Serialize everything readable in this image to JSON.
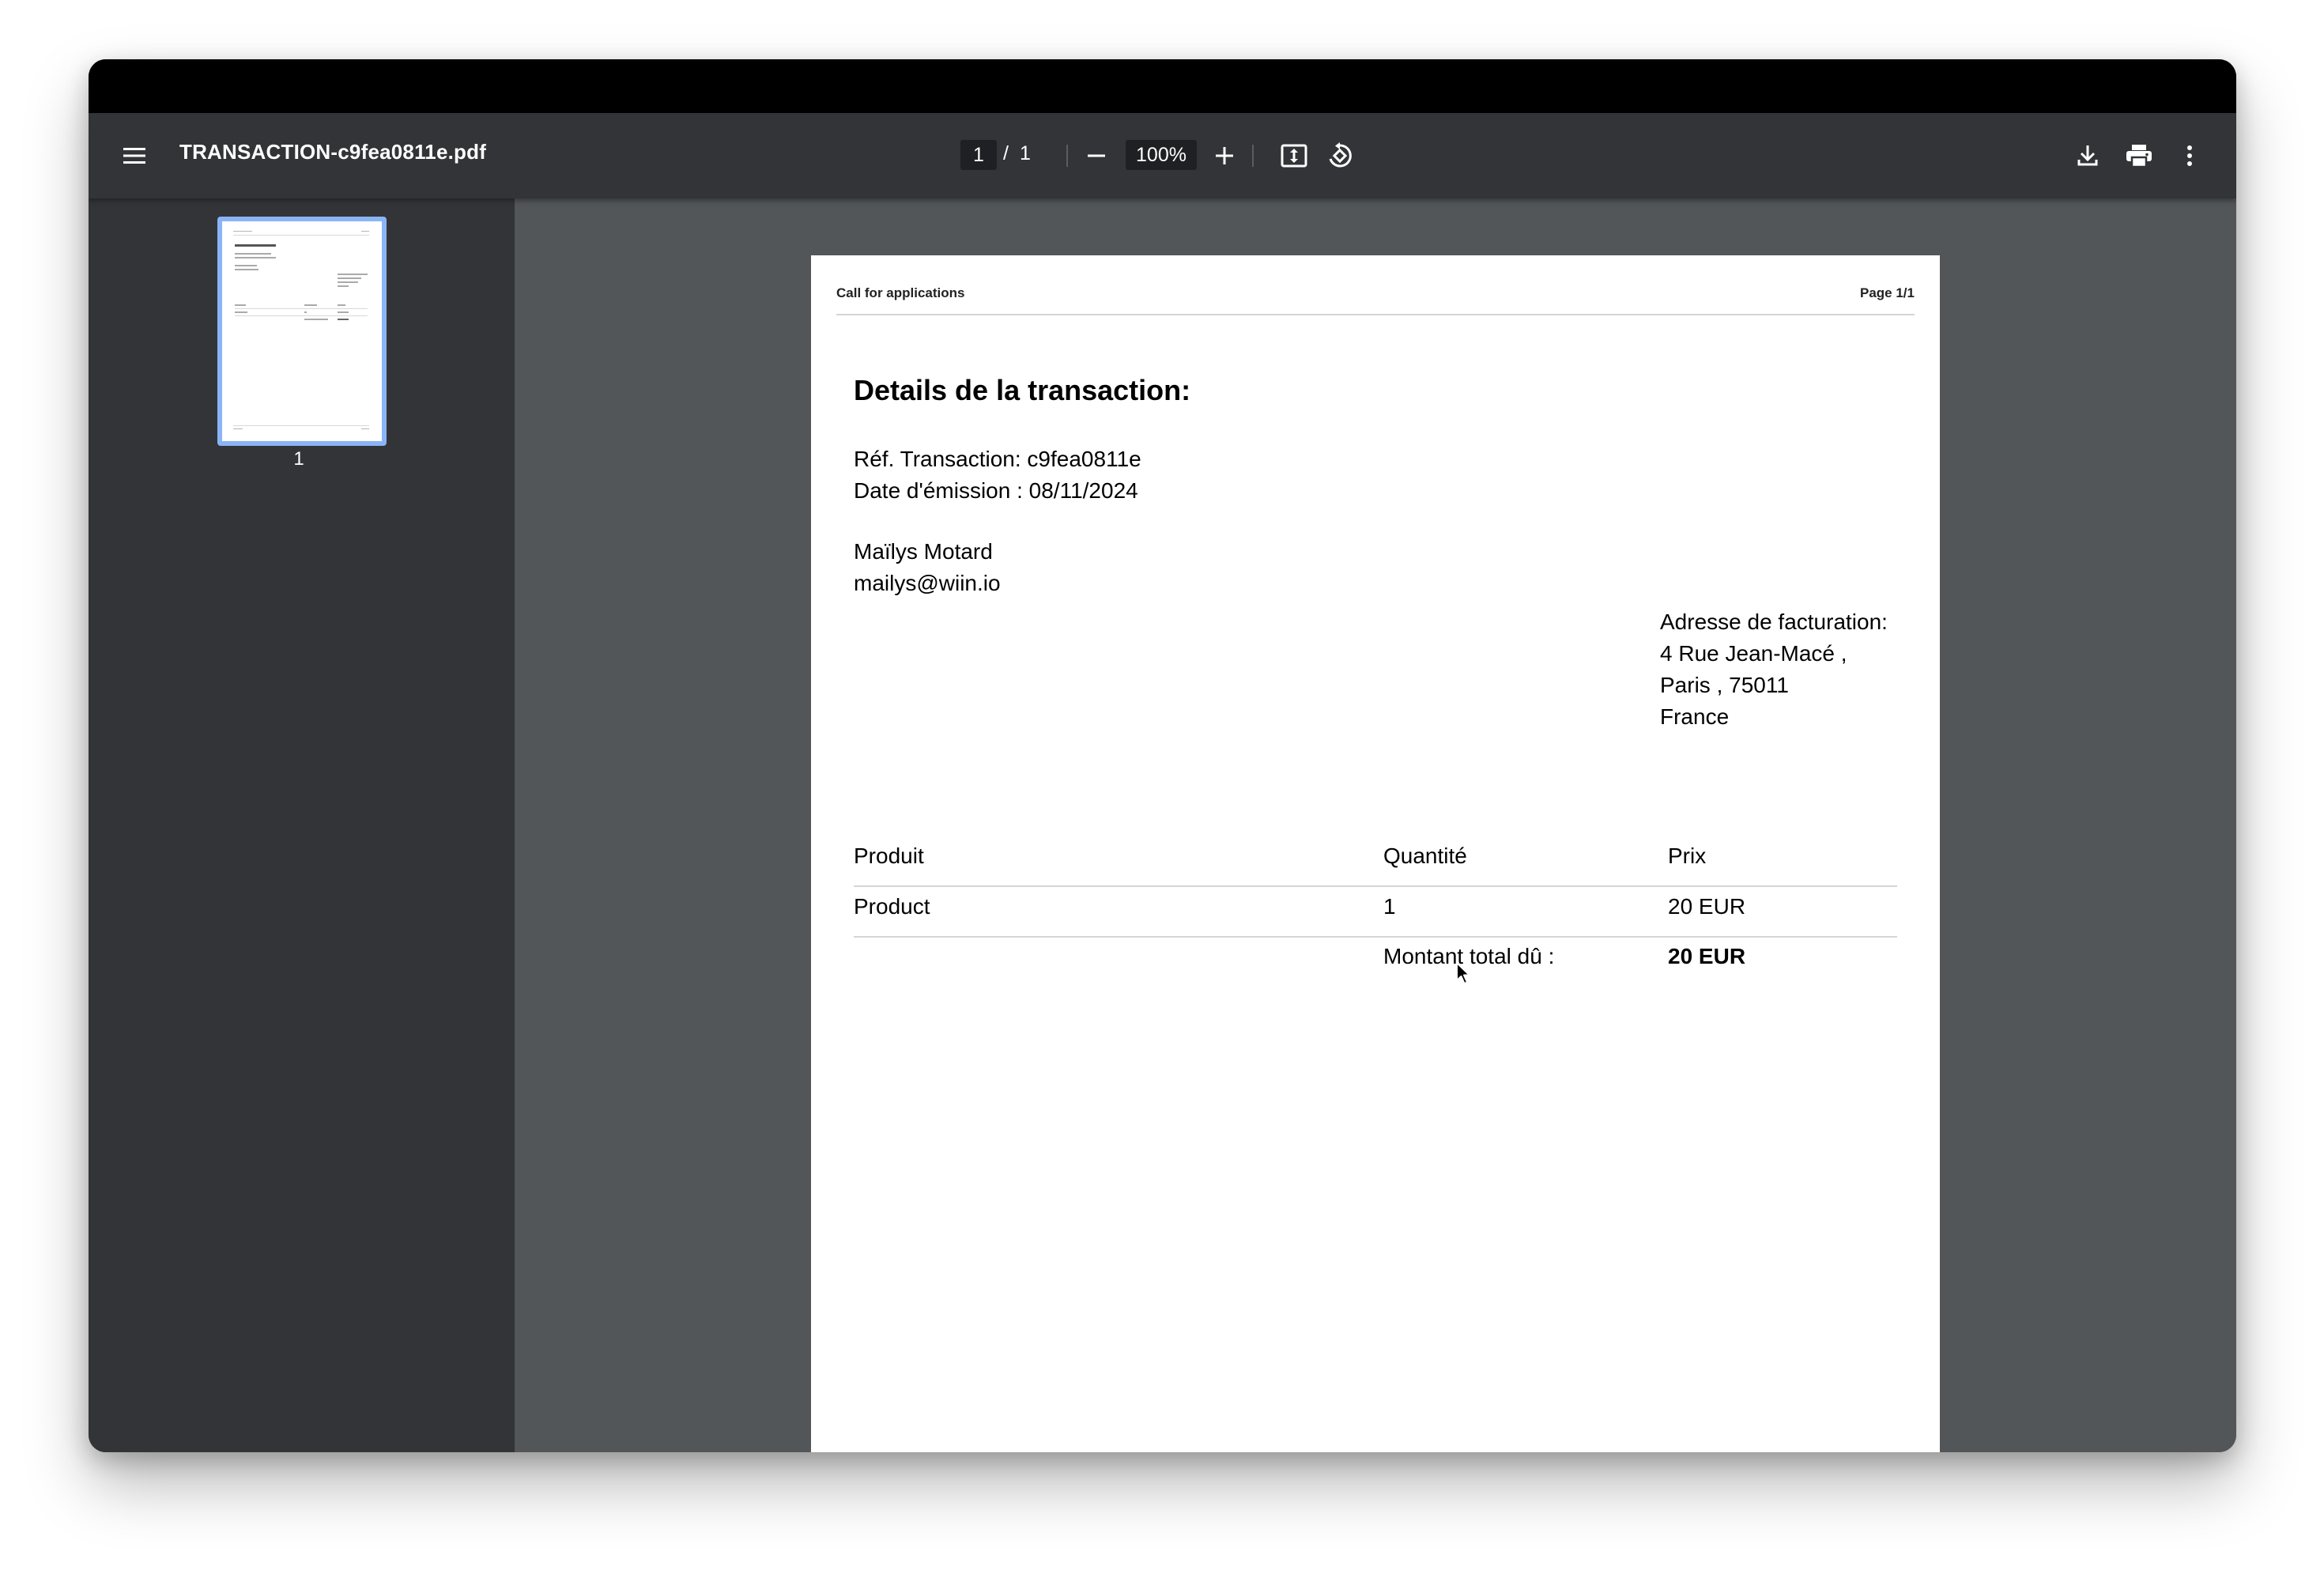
{
  "window": {
    "file_name": "TRANSACTION-c9fea0811e.pdf"
  },
  "toolbar": {
    "menu_icon": "hamburger-menu-icon",
    "current_page": "1",
    "page_separator": "/",
    "total_pages": "1",
    "zoom_level": "100%",
    "icons": [
      "minus-icon",
      "plus-icon",
      "fit-page-icon",
      "rotate-icon",
      "download-icon",
      "print-icon",
      "more-vert-icon"
    ]
  },
  "sidebar": {
    "thumbnails": [
      {
        "page_label": "1",
        "selected": true
      }
    ],
    "selected_color": "#8ab4f8"
  },
  "document": {
    "header_left": "Call for applications",
    "header_right": "Page 1/1",
    "title": "Details de la transaction:",
    "reference": "Réf. Transaction: c9fea0811e",
    "issue_date": "Date d'émission : 08/11/2024",
    "customer_name": "Maïlys Motard",
    "customer_email": "mailys@wiin.io",
    "billing": {
      "heading": "Adresse de facturation:",
      "line1": "4 Rue Jean-Macé ,",
      "line2": "Paris , 75011",
      "line3": "France"
    },
    "table": {
      "headers": [
        "Produit",
        "Quantité",
        "Prix"
      ],
      "rows": [
        [
          "Product",
          "1",
          "20 EUR"
        ]
      ],
      "total_label": "Montant total dû :",
      "total_value": "20 EUR"
    }
  }
}
